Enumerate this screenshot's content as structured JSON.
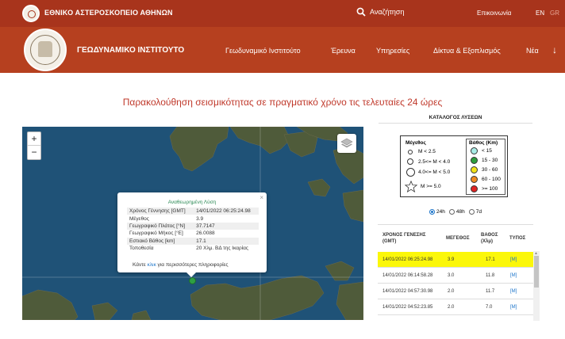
{
  "topbar": {
    "org_title": "ΕΘΝΙΚΟ ΑΣΤΕΡΟΣΚΟΠΕΙΟ ΑΘΗΝΩΝ",
    "search_label": "Αναζήτηση",
    "contact_label": "Επικοινωνία",
    "lang_en": "EN",
    "lang_gr": "GR"
  },
  "navbar": {
    "institute_title": "ΓΕΩΔΥΝΑΜΙΚΟ ΙΝΣΤΙΤΟΥΤΟ",
    "items": [
      "Γεωδυναμικό Ινστιτούτο",
      "Έρευνα",
      "Υπηρεσίες",
      "Δίκτυα & Εξοπλισμός",
      "Νέα"
    ],
    "arrow": "↓"
  },
  "page": {
    "heading": "Παρακολούθηση σεισμικότητας σε πραγματικό χρόνο τις τελευταίες 24 ώρες"
  },
  "map": {
    "zoom_in": "+",
    "zoom_out": "−",
    "popup": {
      "close": "×",
      "title": "Αναθεωρημένη Λύση",
      "fields": [
        {
          "label": "Χρόνος Γέννησης [GMT]",
          "value": "14/01/2022 06:25:24.98"
        },
        {
          "label": "Μέγεθος",
          "value": "3.9"
        },
        {
          "label": "Γεωγραφικό Πλάτος [°N]",
          "value": "37.7147"
        },
        {
          "label": "Γεωγραφικό Μήκος [°E]",
          "value": "26.0088"
        },
        {
          "label": "Εστιακό Βάθος [km]",
          "value": "17.1"
        },
        {
          "label": "Τοποθεσία",
          "value": "20 Χλμ. ΒΔ της Ικαρίας"
        }
      ],
      "more_prefix": "Κάντε ",
      "more_link": "κλικ",
      "more_suffix": " για περισσότερες πληροφορίες"
    }
  },
  "catalog": {
    "title": "ΚΑΤΑΛΟΓΟΣ ΛΥΣΕΩΝ",
    "legend": {
      "magnitude_title": "Μέγεθος",
      "depth_title": "Βάθος (Km)",
      "magnitude_classes": [
        "M < 2.5",
        "2.5<= M < 4.0",
        "4.0<= M < 5.0",
        "M >= 5.0"
      ],
      "depth_classes": [
        {
          "label": "< 15",
          "color": "#a9ece6"
        },
        {
          "label": "15 - 30",
          "color": "#2e9e3e"
        },
        {
          "label": "30 - 60",
          "color": "#f2e21a"
        },
        {
          "label": "60 - 100",
          "color": "#ef8a24"
        },
        {
          "label": ">= 100",
          "color": "#e02424"
        }
      ]
    },
    "period": {
      "options": [
        "24h",
        "48h",
        "7d"
      ],
      "selected": "24h"
    },
    "columns": {
      "time": "ΧΡΟΝΟΣ ΓΕΝΕΣΗΣ",
      "time_sub": "(GMT)",
      "magnitude": "ΜΕΓΕΘΟΣ",
      "depth": "ΒΑΘΟΣ",
      "depth_sub": "(Χλμ)",
      "type": "ΤΥΠΟΣ"
    },
    "rows": [
      {
        "time": "14/01/2022 06:25:24.98",
        "magnitude": "3.9",
        "depth": "17.1",
        "type": "[M]"
      },
      {
        "time": "14/01/2022 06:14:58.28",
        "magnitude": "3.0",
        "depth": "11.8",
        "type": "[M]"
      },
      {
        "time": "14/01/2022 04:57:30.98",
        "magnitude": "2.0",
        "depth": "11.7",
        "type": "[M]"
      },
      {
        "time": "14/01/2022 04:52:23.85",
        "magnitude": "2.0",
        "depth": "7.0",
        "type": "[M]"
      }
    ],
    "highlight_color": "#fbf70a"
  },
  "colors": {
    "topbar": "#a8341c",
    "navbar": "#b6401f",
    "heading": "#c0392b",
    "sea": "#1f5277"
  }
}
